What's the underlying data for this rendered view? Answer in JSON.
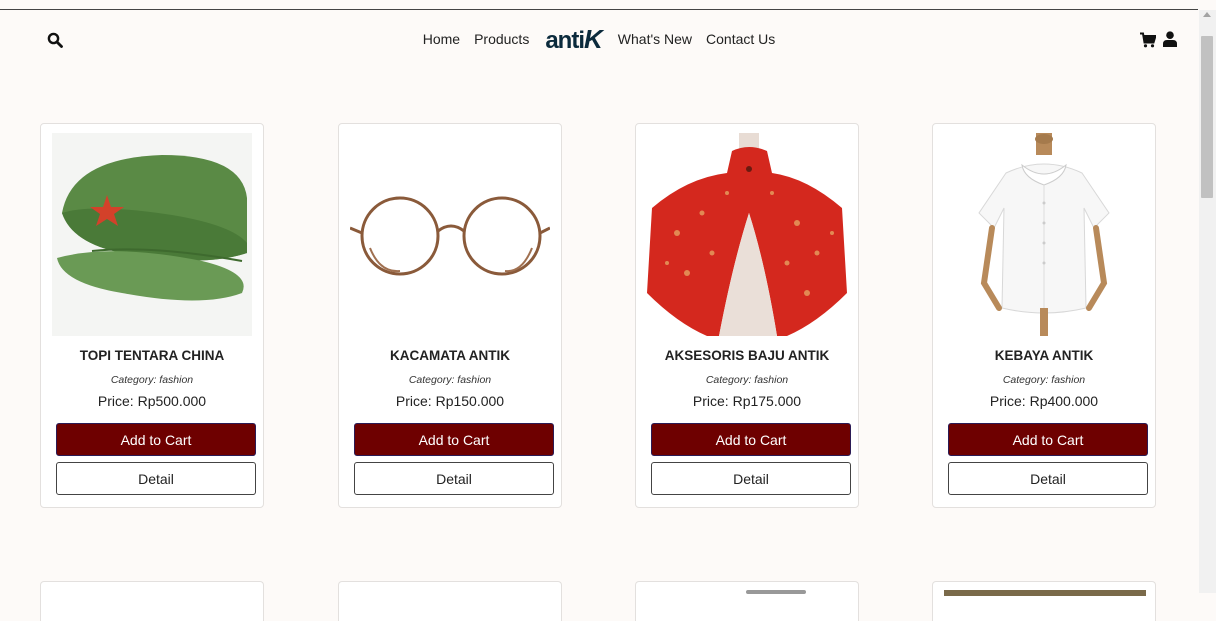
{
  "nav": {
    "links_left": [
      "Home",
      "Products"
    ],
    "logo_text": "anti",
    "logo_k": "K",
    "links_right": [
      "What's New",
      "Contact Us"
    ]
  },
  "products": [
    {
      "name": "TOPI TENTARA CHINA",
      "category": "Category: fashion",
      "price": "Price: Rp500.000",
      "image": "green-army-cap"
    },
    {
      "name": "KACAMATA ANTIK",
      "category": "Category: fashion",
      "price": "Price: Rp150.000",
      "image": "round-glasses"
    },
    {
      "name": "AKSESORIS BAJU ANTIK",
      "category": "Category: fashion",
      "price": "Price: Rp175.000",
      "image": "red-cape"
    },
    {
      "name": "KEBAYA ANTIK",
      "category": "Category: fashion",
      "price": "Price: Rp400.000",
      "image": "white-blouse"
    }
  ],
  "buttons": {
    "add_to_cart": "Add to Cart",
    "detail": "Detail"
  },
  "colors": {
    "primary_button": "#6e0000",
    "logo": "#0b2a3c",
    "page_bg": "#fdfaf8"
  }
}
